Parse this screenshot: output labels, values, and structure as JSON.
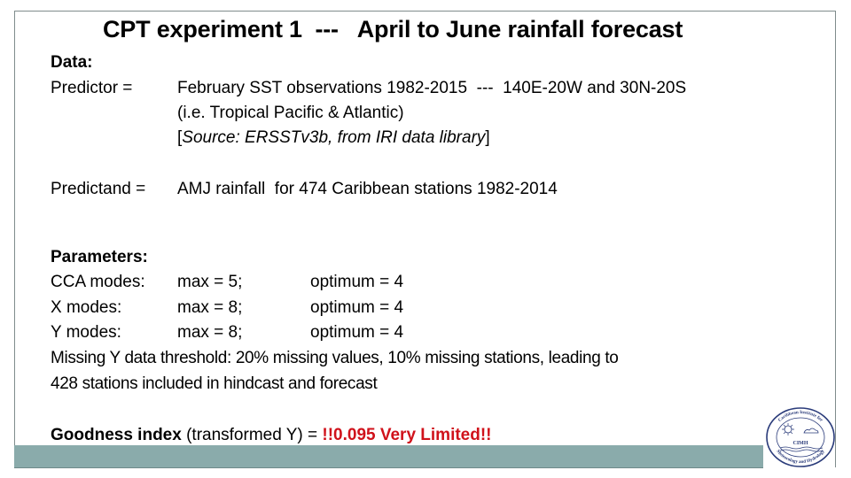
{
  "title": "CPT experiment 1  ---   April to June rainfall forecast",
  "data_section": {
    "heading": "Data:",
    "predictor_label": "Predictor =",
    "predictor_line1": "February SST observations 1982-2015  ---  140E-20W and 30N-20S",
    "predictor_line2": "(i.e. Tropical Pacific & Atlantic)",
    "predictor_source_open": "[",
    "predictor_source_italic": "Source: ERSSTv3b, from IRI data library",
    "predictor_source_close": "]",
    "predictand_label": "Predictand =",
    "predictand_value": "AMJ rainfall  for 474 Caribbean stations 1982-2014"
  },
  "parameters": {
    "heading": "Parameters:",
    "rows": [
      {
        "label": "CCA modes:",
        "max": "max = 5;",
        "optimum": "optimum = 4"
      },
      {
        "label": "X modes:",
        "max": "max = 8;",
        "optimum": "optimum = 4"
      },
      {
        "label": "Y modes:",
        "max": "max = 8;",
        "optimum": "optimum = 4"
      }
    ],
    "missing_line1": "Missing Y data threshold: 20% missing values, 10% missing stations, leading to",
    "missing_line2": "428 stations included in hindcast and forecast"
  },
  "goodness": {
    "label_bold": "Goodness index",
    "label_rest": " (transformed Y) = ",
    "value": "!!0.095 Very Limited!!"
  },
  "logo": {
    "text_top": "Caribbean Institute for",
    "acronym": "CIMH",
    "text_bottom": "Meteorology and Hydrology"
  },
  "colors": {
    "accent_bar": "#8aabab",
    "warning_red": "#d0121b"
  }
}
